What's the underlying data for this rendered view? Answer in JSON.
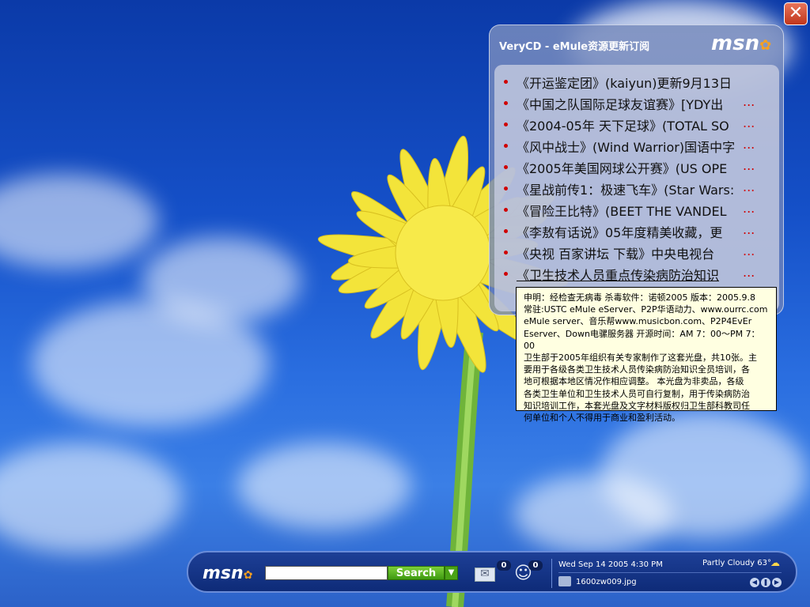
{
  "panel": {
    "title": "VeryCD - eMule资源更新订阅",
    "logo": "msn",
    "news": [
      {
        "text": "《开运鉴定团》(kaiyun)更新9月13日",
        "truncated": false
      },
      {
        "text": "《中国之队国际足球友谊赛》[YDY出",
        "truncated": true
      },
      {
        "text": "《2004-05年  天下足球》(TOTAL SO",
        "truncated": true
      },
      {
        "text": "《风中战士》(Wind Warrior)国语中字",
        "truncated": true
      },
      {
        "text": "《2005年美国网球公开赛》(US OPE",
        "truncated": true
      },
      {
        "text": "《星战前传1：极速飞车》(Star Wars:",
        "truncated": true
      },
      {
        "text": "《冒险王比特》(BEET THE VANDEL",
        "truncated": true
      },
      {
        "text": "《李敖有话说》05年度精美收藏，更",
        "truncated": true
      },
      {
        "text": "《央视  百家讲坛  下载》中央电视台",
        "truncated": true
      },
      {
        "text": "《卫生技术人员重点传染病防治知识",
        "truncated": true
      }
    ],
    "ellipsis": "..."
  },
  "tooltip": {
    "lines": [
      "申明：经检查无病毒  杀毒软件：诺顿2005 版本：2005.9.8",
      "常驻:USTC eMule eServer、P2P华语动力、www.ourrc.com",
      "eMule server、音乐帮www.musicbon.com、P2P4EvEr",
      "Eserver、Down电骡服务器  开源时间：AM 7：00～PM 7：00",
      "卫生部于2005年组织有关专家制作了这套光盘，共10张。主",
      "要用于各级各类卫生技术人员传染病防治知识全员培训，各",
      "地可根据本地区情况作相应调整。  本光盘为非卖品，各级",
      "各类卫生单位和卫生技术人员可自行复制，用于传染病防治",
      "知识培训工作，本套光盘及文字材料版权归卫生部科教司任",
      "何单位和个人不得用于商业和盈利活动。"
    ]
  },
  "close_button": {
    "label": "✕"
  },
  "taskbar": {
    "logo": "msn",
    "search_value": "",
    "search_label": "Search",
    "mail_count": "0",
    "messenger_count": "0",
    "datetime": "Wed Sep 14 2005 4:30 PM",
    "weather": "Partly Cloudy 63°",
    "wallpaper_file": "1600zw009.jpg"
  },
  "colors": {
    "bullet": "#d00000",
    "search_button": "#4aa216",
    "tooltip_bg": "#ffffe1"
  },
  "icons": [
    "close-icon",
    "msn-butterfly-icon",
    "bullet-icon",
    "mail-icon",
    "messenger-buddy-icon",
    "weather-icon",
    "camera-icon",
    "previous-icon",
    "pause-icon",
    "next-icon",
    "dropdown-arrow-icon"
  ]
}
